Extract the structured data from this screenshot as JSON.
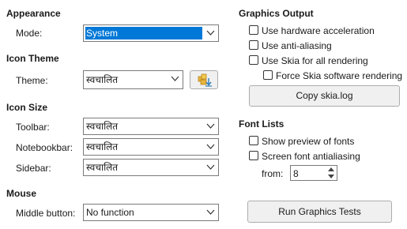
{
  "appearance": {
    "heading": "Appearance",
    "mode_label": "Mode:",
    "mode_value": "System"
  },
  "icon_theme": {
    "heading": "Icon Theme",
    "theme_label": "Theme:",
    "theme_value": "स्वचालित"
  },
  "icon_size": {
    "heading": "Icon Size",
    "toolbar_label": "Toolbar:",
    "toolbar_value": "स्वचालित",
    "notebookbar_label": "Notebookbar:",
    "notebookbar_value": "स्वचालित",
    "sidebar_label": "Sidebar:",
    "sidebar_value": "स्वचालित"
  },
  "mouse": {
    "heading": "Mouse",
    "middle_button_label": "Middle button:",
    "middle_button_value": "No function"
  },
  "graphics_output": {
    "heading": "Graphics Output",
    "hardware_accel": {
      "label": "Use hardware acceleration",
      "checked": false
    },
    "anti_aliasing": {
      "label": "Use anti-aliasing",
      "checked": false
    },
    "skia_all": {
      "label": "Use Skia for all rendering",
      "checked": false
    },
    "force_skia_sw": {
      "label": "Force Skia software rendering",
      "checked": false
    },
    "copy_skia_log": "Copy skia.log"
  },
  "font_lists": {
    "heading": "Font Lists",
    "show_preview": {
      "label": "Show preview of fonts",
      "checked": false
    },
    "screen_antialiasing": {
      "label": "Screen font antialiasing",
      "checked": false
    },
    "from_label": "from:",
    "from_value": "8"
  },
  "run_tests_button": "Run Graphics Tests",
  "icons": {
    "dropdown_arrow": "chevron-down-icon",
    "add_extension": "add-icon-theme-icon",
    "spin_up": "spin-up-icon",
    "spin_down": "spin-down-icon"
  },
  "colors": {
    "selection": "#0078d7",
    "button_face": "#f0f0f0"
  }
}
